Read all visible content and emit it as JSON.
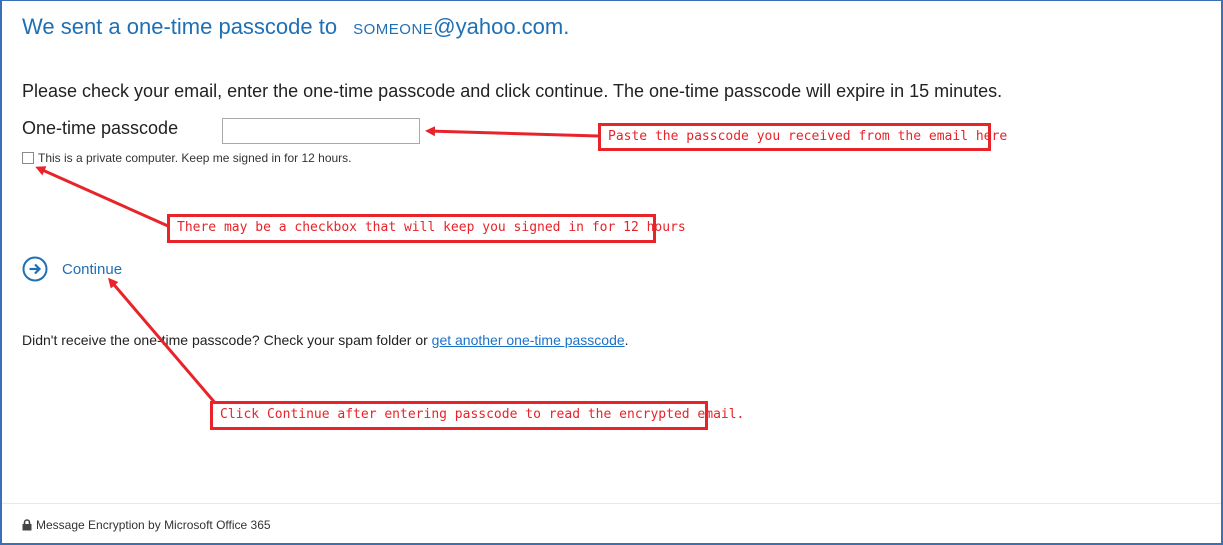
{
  "heading": {
    "text": "We sent a one-time passcode to",
    "email_user": "SOMEONE",
    "email_domain": "@yahoo.com."
  },
  "instructions": "Please check your email, enter the one-time passcode and click continue. The one-time passcode will expire in 15 minutes.",
  "passcode": {
    "label": "One-time passcode",
    "value": "",
    "placeholder": ""
  },
  "keep_signed_in": {
    "label": "This is a private computer. Keep me signed in for 12 hours.",
    "checked": false
  },
  "continue": {
    "label": "Continue",
    "icon": "arrow-right-circle-icon"
  },
  "resend": {
    "prefix": "Didn't receive the one-time passcode? Check your spam folder or",
    "link_label": "get another one-time passcode",
    "suffix": "."
  },
  "footer": {
    "text": "Message Encryption by Microsoft Office 365",
    "icon": "lock-icon"
  },
  "annotations": {
    "passcode_tip": "Paste the passcode you received from the email here",
    "checkbox_tip": "There may be a checkbox that will keep you signed in for 12 hours",
    "continue_tip": "Click Continue after entering passcode to read the encrypted email."
  },
  "colors": {
    "heading": "#1f6fb5",
    "link": "#1a73c8",
    "annotation": "#e8232a",
    "frame": "#3b6fb6"
  }
}
